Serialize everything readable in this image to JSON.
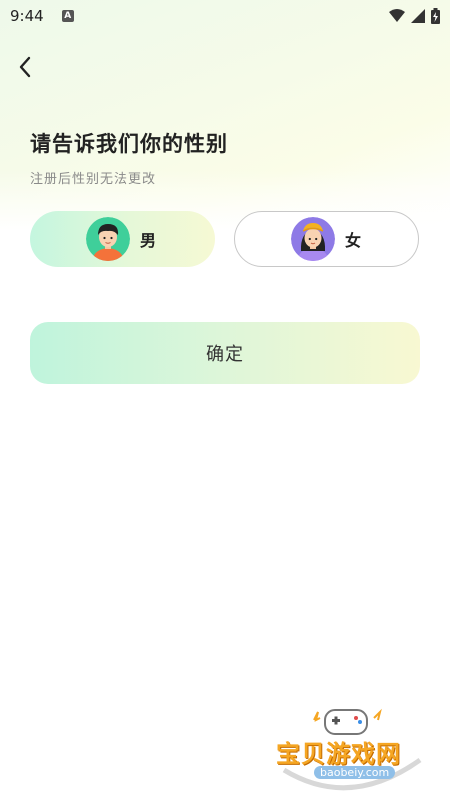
{
  "status_bar": {
    "time": "9:44",
    "notification_icon_letter": "A",
    "icons": [
      "wifi-icon",
      "signal-icon",
      "battery-icon"
    ]
  },
  "header": {
    "back_icon": "chevron-left-icon",
    "title": "请告诉我们你的性别",
    "subtitle": "注册后性别无法更改"
  },
  "gender_options": [
    {
      "label": "男",
      "selected": true,
      "avatar": "male-avatar"
    },
    {
      "label": "女",
      "selected": false,
      "avatar": "female-avatar"
    }
  ],
  "confirm": {
    "label": "确定"
  },
  "watermark": {
    "text": "宝贝游戏网",
    "url": "baobeiy.com"
  },
  "colors": {
    "accent_start": "#bff4dc",
    "accent_end": "#f8f8d2",
    "text_primary": "#222222",
    "text_secondary": "#8a8a8a"
  }
}
